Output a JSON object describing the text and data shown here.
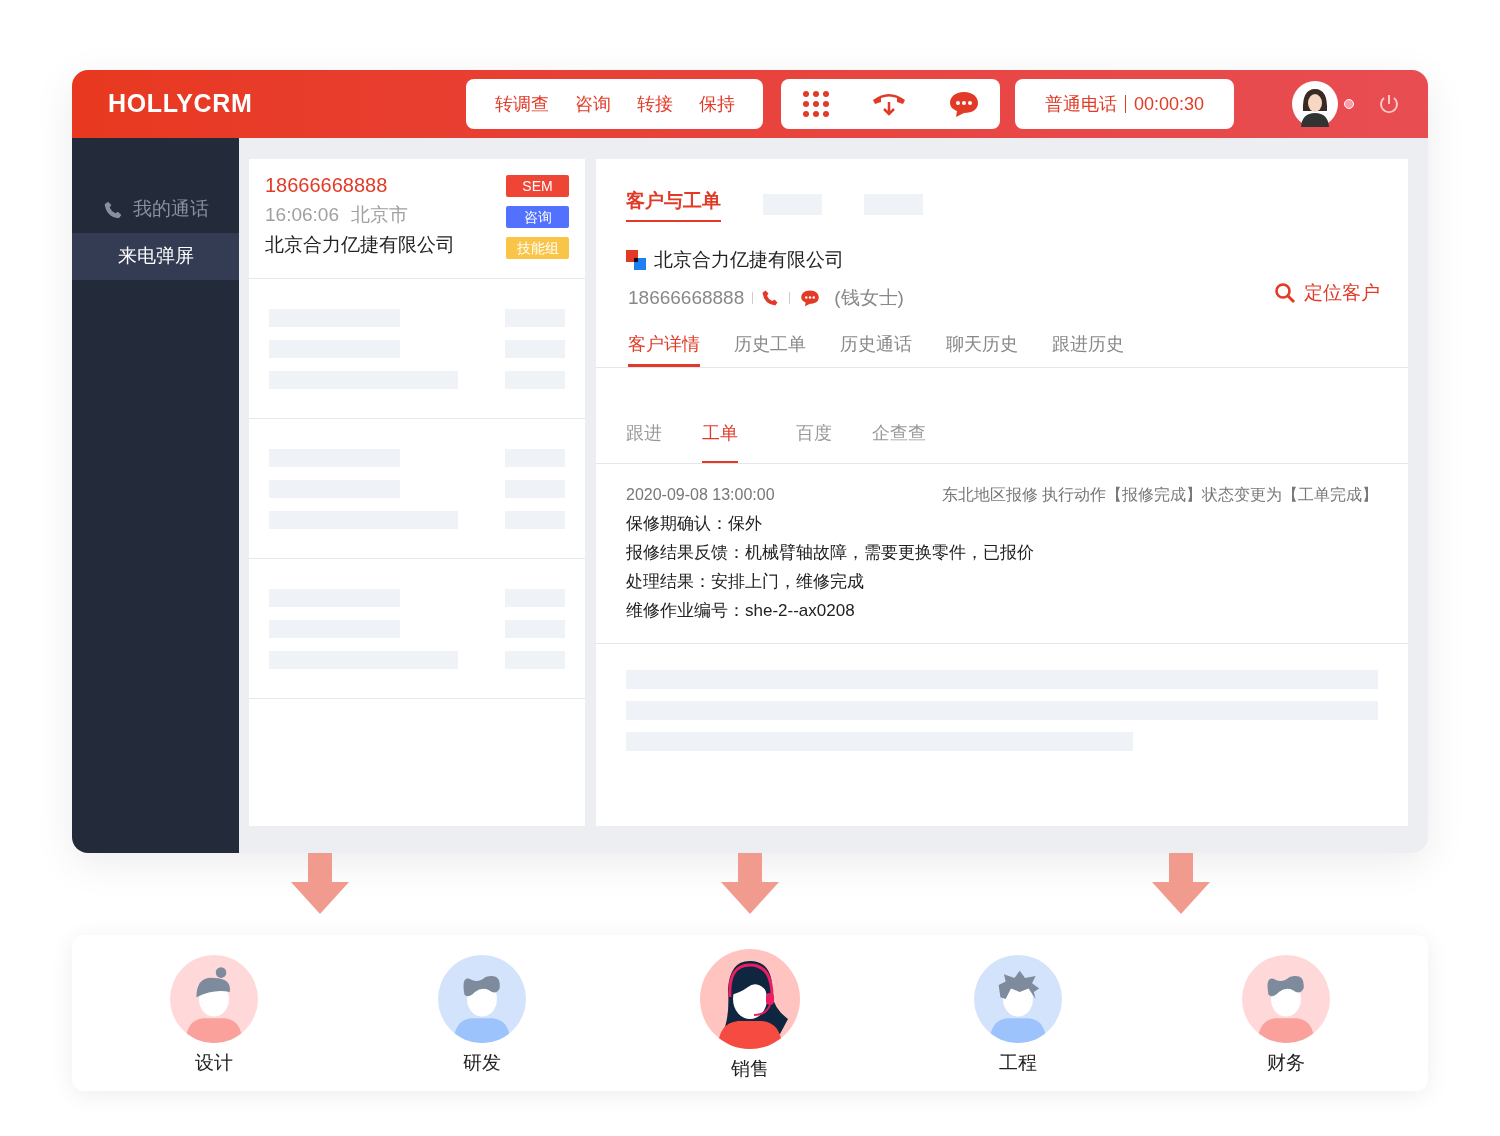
{
  "header": {
    "logo": "HOLLYCRM",
    "call_actions": [
      "转调查",
      "咨询",
      "转接",
      "保持"
    ],
    "call_status": {
      "type": "普通电话",
      "timer": "00:00:30"
    },
    "online": true
  },
  "sidebar": {
    "items": [
      {
        "label": "我的通话",
        "selected": false,
        "kind": "call"
      },
      {
        "label": "来电弹屏",
        "selected": true,
        "kind": "plain"
      }
    ]
  },
  "call_card": {
    "phone": "18666668888",
    "time": "16:06:06",
    "city": "北京市",
    "company": "北京合力亿捷有限公司",
    "tags": [
      {
        "label": "SEM",
        "color": "#ee4535"
      },
      {
        "label": "咨询",
        "color": "#5271ff"
      },
      {
        "label": "技能组",
        "color": "#f8c548"
      }
    ]
  },
  "customer": {
    "tabs": [
      {
        "label": "客户与工单",
        "selected": true
      }
    ],
    "company": "北京合力亿捷有限公司",
    "phone": "18666668888",
    "contact": "(钱女士)",
    "locate": "定位客户",
    "detail_tabs": [
      {
        "label": "客户详情",
        "selected": true
      },
      {
        "label": "历史工单",
        "selected": false
      },
      {
        "label": "历史通话",
        "selected": false
      },
      {
        "label": "聊天历史",
        "selected": false
      },
      {
        "label": "跟进历史",
        "selected": false
      }
    ],
    "sub_tabs": [
      {
        "label": "跟进",
        "selected": false
      },
      {
        "label": "工单",
        "selected": true
      },
      {
        "label": "百度",
        "selected": false
      },
      {
        "label": "企查查",
        "selected": false
      }
    ],
    "record": {
      "datetime": "2020-09-08 13:00:00",
      "event": "东北地区报修 执行动作【报修完成】状态变更为【工单完成】",
      "lines": [
        "保修期确认：保外",
        "报修结果反馈：机械臂轴故障，需要更换零件，已报价",
        "处理结果：安排上门，维修完成",
        "维修作业编号：she-2--ax0208"
      ]
    }
  },
  "departments": [
    {
      "label": "设计",
      "kind": "bun",
      "color": "#ffd9d9",
      "selected": false
    },
    {
      "label": "研发",
      "kind": "wavy",
      "color": "#d3e3fb",
      "selected": false
    },
    {
      "label": "销售",
      "kind": "headset",
      "color": "#ffc4c0",
      "selected": true
    },
    {
      "label": "工程",
      "kind": "spiky",
      "color": "#d3e3fb",
      "selected": false
    },
    {
      "label": "财务",
      "kind": "wavy",
      "color": "#ffd9d9",
      "selected": false
    }
  ]
}
